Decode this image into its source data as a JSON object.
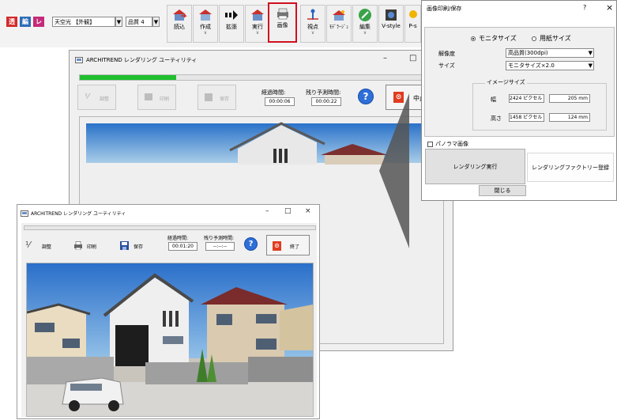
{
  "toolbar": {
    "transparency_btn": "透",
    "edit_btn": "編",
    "layer_btn": "レ",
    "light_select": "天空光 【外観】",
    "quality_select": "品質 4",
    "buttons": [
      {
        "label": "読込",
        "icon": "load-icon"
      },
      {
        "label": "作成",
        "icon": "create-icon"
      },
      {
        "label": "拡張",
        "icon": "extend-icon"
      },
      {
        "label": "実行",
        "icon": "run-icon"
      },
      {
        "label": "画像",
        "icon": "image-icon"
      },
      {
        "label": "視点",
        "icon": "viewpoint-icon"
      },
      {
        "label": "ﾓﾃﾞﾗｰｼﾞｭ",
        "icon": "modelage-icon"
      },
      {
        "label": "編集",
        "icon": "edit-icon"
      },
      {
        "label": "V-style",
        "icon": "vstyle-icon"
      },
      {
        "label": "P-s",
        "icon": "ps-icon"
      }
    ]
  },
  "back_window": {
    "title": "ARCHITREND レンダリング ユーティリティ",
    "progress": 0.27,
    "adjust_label": "調整",
    "print_label": "印刷",
    "save_label": "保存",
    "elapsed_label": "経過時間:",
    "elapsed_value": "00:00:06",
    "remaining_label": "残り予測時間:",
    "remaining_value": "00:00:22",
    "stop_label": "中止"
  },
  "front_window": {
    "title": "ARCHITREND レンダリング ユーティリティ",
    "progress": 0,
    "adjust_label": "調整",
    "print_label": "印刷",
    "save_label": "保存",
    "elapsed_label": "経過時間:",
    "elapsed_value": "00:01:20",
    "remaining_label": "残り予測時間:",
    "remaining_value": "--:--:--",
    "end_label": "終了"
  },
  "dialog": {
    "title": "画像印刷/保存",
    "help": "?",
    "close": "×",
    "radio_monitor": "モニタサイズ",
    "radio_paper": "用紙サイズ",
    "resolution_label": "解像度",
    "resolution_value": "高品質(300dpi)",
    "size_label": "サイズ",
    "size_value": "モニタサイズ×2.0",
    "group_label": "イメージサイズ",
    "width_label": "幅",
    "width_px": "2424",
    "width_mm": "205",
    "height_label": "高さ",
    "height_px": "1458",
    "height_mm": "124",
    "px_unit": "ピクセル",
    "mm_unit": "mm",
    "panorama_label": "パノラマ画像",
    "render_button": "レンダリング実行",
    "factory_button": "レンダリングファクトリー登録",
    "close_button": "閉じる"
  },
  "colors": {
    "accent_red": "#d0101e",
    "progress_green": "#1fbf2f",
    "help_blue": "#2e6fd8",
    "stop_red": "#e03c1f"
  }
}
